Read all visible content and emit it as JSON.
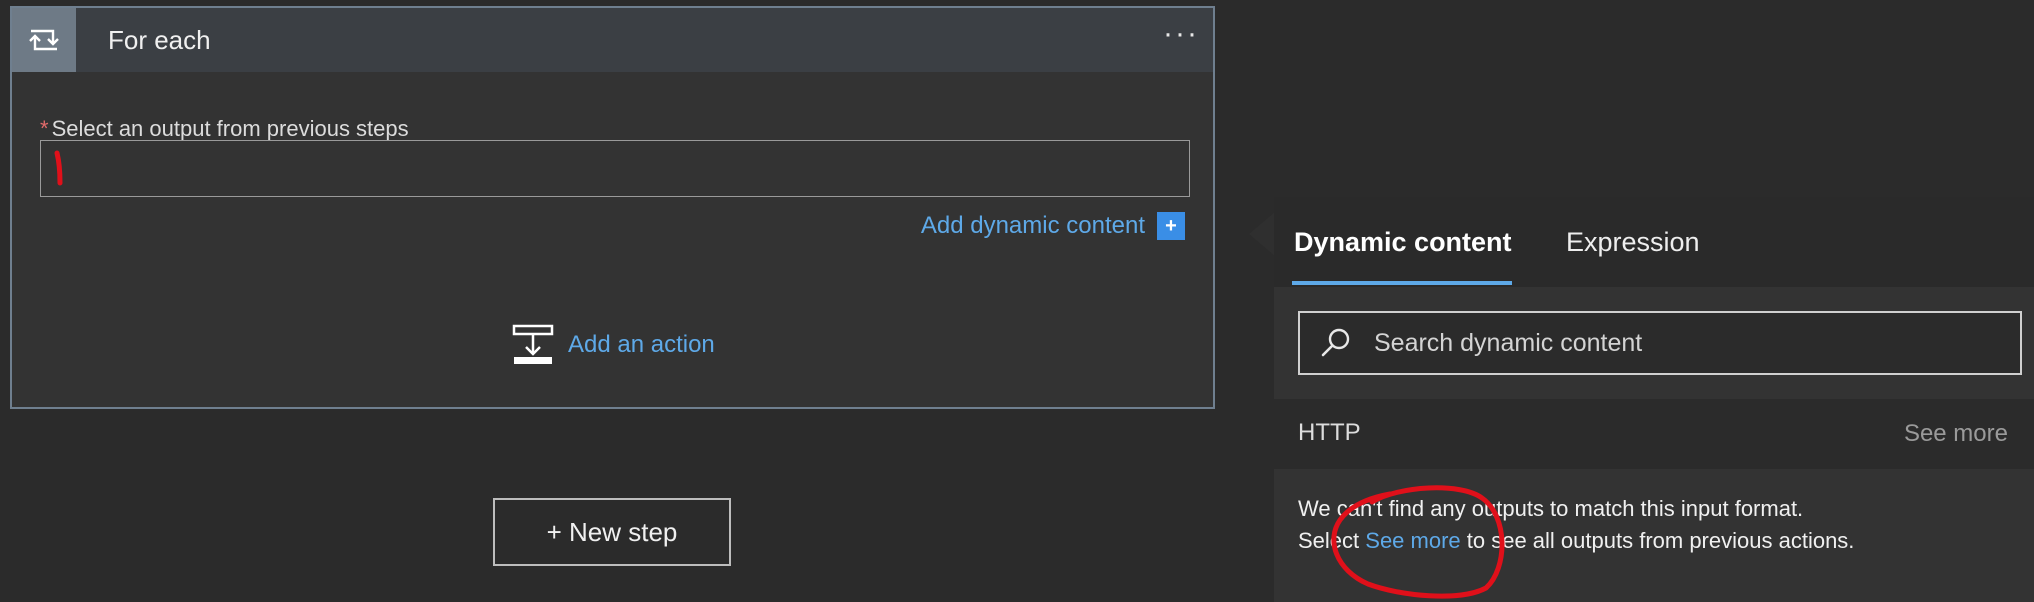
{
  "card": {
    "title": "For each",
    "more_label": "···",
    "required_mark": "*",
    "field_label": "Select an output from previous steps",
    "field_value": "",
    "add_dynamic_label": "Add dynamic content",
    "add_dynamic_icon": "+",
    "add_action_label": "Add an action",
    "icon": "loop-icon"
  },
  "new_step": {
    "label": "+ New step"
  },
  "panel": {
    "tabs": [
      "Dynamic content",
      "Expression"
    ],
    "active_tab": "Dynamic content",
    "search": {
      "placeholder": "Search dynamic content",
      "value": ""
    },
    "section": {
      "label": "HTTP",
      "see_more": "See more"
    },
    "message_line1": "We can't find any outputs to match this input format.",
    "message_line2_prefix": "Select ",
    "message_line2_link": "See more",
    "message_line2_suffix": " to see all outputs from previous actions."
  },
  "colors": {
    "accent": "#5ea9e8",
    "annotation": "#e0101a",
    "required": "#e26b6b"
  }
}
